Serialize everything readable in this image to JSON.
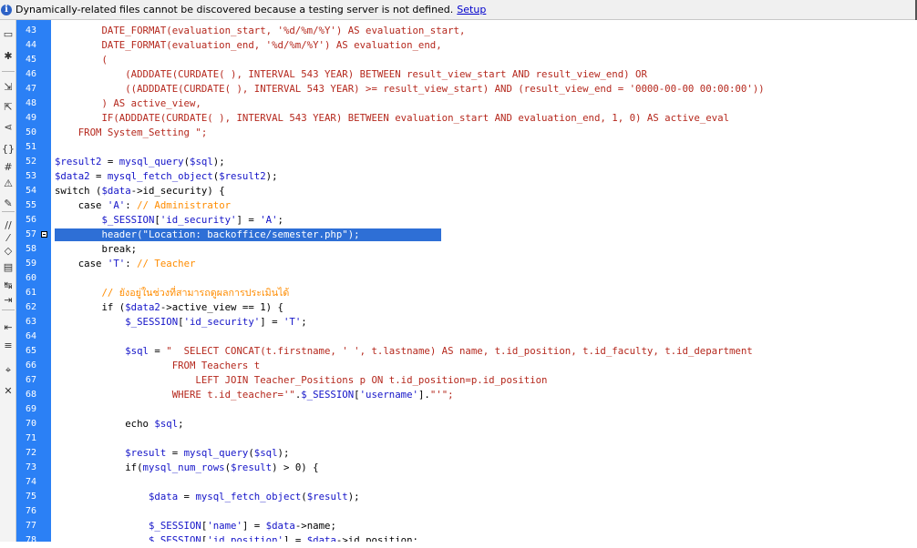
{
  "infobar": {
    "message": "Dynamically-related files cannot be discovered because a testing server is not defined.",
    "link_label": "Setup"
  },
  "toolbar_icons": [
    "file-management-icon",
    "asterisk-icon",
    "expand-icon",
    "collapse-icon",
    "select-parent-tag-icon",
    "balance-braces-icon",
    "line-numbers-icon",
    "highlight-invalid-code-icon",
    "syntax-coloring-icon",
    "comment-icon",
    "uncomment-icon",
    "wrap-tag-icon",
    "recent-snippets-icon",
    "move-css-icon",
    "indent-icon",
    "outdent-icon",
    "format-source-icon",
    "apply-source-formatting-icon",
    "remove-tag-icon"
  ],
  "gutter": {
    "line_numbers": [
      "43",
      "44",
      "45",
      "46",
      "47",
      "48",
      "49",
      "50",
      "51",
      "52",
      "53",
      "54",
      "55",
      "56",
      "57",
      "58",
      "59",
      "60",
      "61",
      "62",
      "63",
      "64",
      "65",
      "66",
      "67",
      "68",
      "69",
      "70",
      "71",
      "72",
      "73",
      "74",
      "75",
      "76",
      "77",
      "78"
    ],
    "selected_line": "57"
  },
  "code_lines": [
    [
      {
        "t": "        DATE_FORMAT(evaluation_start, '%d/%m/%Y') AS evaluation_start,",
        "c": "sql"
      }
    ],
    [
      {
        "t": "        DATE_FORMAT(evaluation_end, '%d/%m/%Y') AS evaluation_end,",
        "c": "sql"
      }
    ],
    [
      {
        "t": "        (",
        "c": "sql"
      }
    ],
    [
      {
        "t": "            (ADDDATE(CURDATE( ), INTERVAL 543 YEAR) BETWEEN result_view_start AND result_view_end) OR",
        "c": "sql"
      }
    ],
    [
      {
        "t": "            ((ADDDATE(CURDATE( ), INTERVAL 543 YEAR) >= result_view_start) AND (result_view_end = '0000-00-00 00:00:00'))",
        "c": "sql"
      }
    ],
    [
      {
        "t": "        ) AS active_view,",
        "c": "sql"
      }
    ],
    [
      {
        "t": "        IF(ADDDATE(CURDATE( ), INTERVAL 543 YEAR) BETWEEN evaluation_start AND evaluation_end, 1, 0) AS active_eval",
        "c": "sql"
      }
    ],
    [
      {
        "t": "    FROM System_Setting \";",
        "c": "sql"
      }
    ],
    [],
    [
      {
        "t": "$result2",
        "c": "var"
      },
      {
        "t": " = ",
        "c": "kw"
      },
      {
        "t": "mysql_query",
        "c": "var"
      },
      {
        "t": "(",
        "c": "kw"
      },
      {
        "t": "$sql",
        "c": "var"
      },
      {
        "t": ");",
        "c": "kw"
      }
    ],
    [
      {
        "t": "$data2",
        "c": "var"
      },
      {
        "t": " = ",
        "c": "kw"
      },
      {
        "t": "mysql_fetch_object",
        "c": "var"
      },
      {
        "t": "(",
        "c": "kw"
      },
      {
        "t": "$result2",
        "c": "var"
      },
      {
        "t": ");",
        "c": "kw"
      }
    ],
    [
      {
        "t": "switch (",
        "c": "kw"
      },
      {
        "t": "$data",
        "c": "var"
      },
      {
        "t": "->id_security) {",
        "c": "kw"
      }
    ],
    [
      {
        "t": "    case ",
        "c": "kw"
      },
      {
        "t": "'A'",
        "c": "str"
      },
      {
        "t": ": ",
        "c": "kw"
      },
      {
        "t": "// Administrator",
        "c": "cmt"
      }
    ],
    [
      {
        "t": "        $_SESSION",
        "c": "var"
      },
      {
        "t": "[",
        "c": "kw"
      },
      {
        "t": "'id_security'",
        "c": "str"
      },
      {
        "t": "] = ",
        "c": "kw"
      },
      {
        "t": "'A'",
        "c": "str"
      },
      {
        "t": ";",
        "c": "kw"
      }
    ],
    [
      {
        "t": "        header(\"Location: backoffice/semester.php\");",
        "c": "sel"
      }
    ],
    [
      {
        "t": "        break;",
        "c": "kw"
      }
    ],
    [
      {
        "t": "    case ",
        "c": "kw"
      },
      {
        "t": "'T'",
        "c": "str"
      },
      {
        "t": ": ",
        "c": "kw"
      },
      {
        "t": "// Teacher",
        "c": "cmt"
      }
    ],
    [],
    [
      {
        "t": "        // ยังอยู่ในช่วงที่สามารถดูผลการประเมินได้",
        "c": "cmt"
      }
    ],
    [
      {
        "t": "        if (",
        "c": "kw"
      },
      {
        "t": "$data2",
        "c": "var"
      },
      {
        "t": "->active_view == 1) {",
        "c": "kw"
      }
    ],
    [
      {
        "t": "            $_SESSION",
        "c": "var"
      },
      {
        "t": "[",
        "c": "kw"
      },
      {
        "t": "'id_security'",
        "c": "str"
      },
      {
        "t": "] = ",
        "c": "kw"
      },
      {
        "t": "'T'",
        "c": "str"
      },
      {
        "t": ";",
        "c": "kw"
      }
    ],
    [],
    [
      {
        "t": "            $sql",
        "c": "var"
      },
      {
        "t": " = ",
        "c": "kw"
      },
      {
        "t": "\"  SELECT CONCAT(t.firstname, ' ', t.lastname) AS name, t.id_position, t.id_faculty, t.id_department",
        "c": "sql"
      }
    ],
    [
      {
        "t": "                    FROM Teachers t",
        "c": "sql"
      }
    ],
    [
      {
        "t": "                        LEFT JOIN Teacher_Positions p ON t.id_position=p.id_position",
        "c": "sql"
      }
    ],
    [
      {
        "t": "                    WHERE t.id_teacher='\"",
        "c": "sql"
      },
      {
        "t": ".",
        "c": "kw"
      },
      {
        "t": "$_SESSION",
        "c": "var"
      },
      {
        "t": "[",
        "c": "kw"
      },
      {
        "t": "'username'",
        "c": "str"
      },
      {
        "t": "].",
        "c": "kw"
      },
      {
        "t": "\"'\";",
        "c": "sql"
      }
    ],
    [],
    [
      {
        "t": "            echo ",
        "c": "kw"
      },
      {
        "t": "$sql",
        "c": "var"
      },
      {
        "t": ";",
        "c": "kw"
      }
    ],
    [],
    [
      {
        "t": "            $result",
        "c": "var"
      },
      {
        "t": " = ",
        "c": "kw"
      },
      {
        "t": "mysql_query",
        "c": "var"
      },
      {
        "t": "(",
        "c": "kw"
      },
      {
        "t": "$sql",
        "c": "var"
      },
      {
        "t": ");",
        "c": "kw"
      }
    ],
    [
      {
        "t": "            if(",
        "c": "kw"
      },
      {
        "t": "mysql_num_rows",
        "c": "var"
      },
      {
        "t": "(",
        "c": "kw"
      },
      {
        "t": "$result",
        "c": "var"
      },
      {
        "t": ") > 0) {",
        "c": "kw"
      }
    ],
    [],
    [
      {
        "t": "                $data",
        "c": "var"
      },
      {
        "t": " = ",
        "c": "kw"
      },
      {
        "t": "mysql_fetch_object",
        "c": "var"
      },
      {
        "t": "(",
        "c": "kw"
      },
      {
        "t": "$result",
        "c": "var"
      },
      {
        "t": ");",
        "c": "kw"
      }
    ],
    [],
    [
      {
        "t": "                $_SESSION",
        "c": "var"
      },
      {
        "t": "[",
        "c": "kw"
      },
      {
        "t": "'name'",
        "c": "str"
      },
      {
        "t": "] = ",
        "c": "kw"
      },
      {
        "t": "$data",
        "c": "var"
      },
      {
        "t": "->name;",
        "c": "kw"
      }
    ],
    [
      {
        "t": "                $_SESSION",
        "c": "var"
      },
      {
        "t": "[",
        "c": "kw"
      },
      {
        "t": "'id_position'",
        "c": "str"
      },
      {
        "t": "] = ",
        "c": "kw"
      },
      {
        "t": "$data",
        "c": "var"
      },
      {
        "t": "->id_position;",
        "c": "kw"
      }
    ]
  ]
}
